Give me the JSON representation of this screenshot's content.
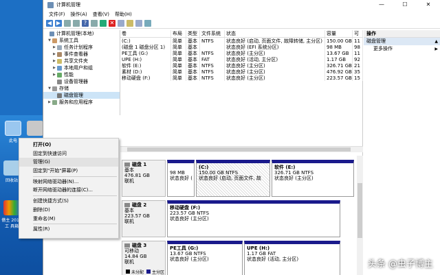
{
  "window": {
    "title": "计算机管理",
    "min": "—",
    "max": "☐",
    "close": "✕"
  },
  "menu": [
    "文件(F)",
    "操作(A)",
    "查看(V)",
    "帮助(H)"
  ],
  "tree": [
    {
      "label": "计算机管理(本地)",
      "level": 0,
      "arrow": ""
    },
    {
      "label": "系统工具",
      "level": 1,
      "arrow": "▼"
    },
    {
      "label": "任务计划程序",
      "level": 2,
      "arrow": "▶"
    },
    {
      "label": "事件查看器",
      "level": 2,
      "arrow": "▶"
    },
    {
      "label": "共享文件夹",
      "level": 2,
      "arrow": "▶"
    },
    {
      "label": "本地用户和组",
      "level": 2,
      "arrow": "▶"
    },
    {
      "label": "性能",
      "level": 2,
      "arrow": "▶"
    },
    {
      "label": "设备管理器",
      "level": 2,
      "arrow": ""
    },
    {
      "label": "存储",
      "level": 1,
      "arrow": "▼"
    },
    {
      "label": "磁盘管理",
      "level": 2,
      "arrow": "",
      "selected": true
    },
    {
      "label": "服务和应用程序",
      "level": 1,
      "arrow": "▶"
    }
  ],
  "volume_table": {
    "headers": [
      "卷",
      "布局",
      "类型",
      "文件系统",
      "状态",
      "容量",
      "可"
    ],
    "rows": [
      [
        "(C:)",
        "简单",
        "基本",
        "NTFS",
        "状态良好 (启动, 页面文件, 故障转储, 主分区)",
        "150.00 GB",
        "11"
      ],
      [
        "(磁盘 1 磁盘分区 1)",
        "简单",
        "基本",
        "",
        "状态良好 (EFI 系统分区)",
        "98 MB",
        "98"
      ],
      [
        "PE工具 (G:)",
        "简单",
        "基本",
        "NTFS",
        "状态良好 (主分区)",
        "13.67 GB",
        "11"
      ],
      [
        "UPE (H:)",
        "简单",
        "基本",
        "FAT",
        "状态良好 (活动, 主分区)",
        "1.17 GB",
        "92"
      ],
      [
        "软件 (E:)",
        "简单",
        "基本",
        "NTFS",
        "状态良好 (主分区)",
        "326.71 GB",
        "21"
      ],
      [
        "素材 (D:)",
        "简单",
        "基本",
        "NTFS",
        "状态良好 (主分区)",
        "476.92 GB",
        "35"
      ],
      [
        "移动硬盘 (F:)",
        "简单",
        "基本",
        "NTFS",
        "状态良好 (主分区)",
        "223.57 GB",
        "15"
      ]
    ]
  },
  "disks": [
    {
      "name": "磁盘 1",
      "type": "基本",
      "size": "476.81 GB",
      "status": "联机",
      "parts": [
        {
          "name": "",
          "size": "98 MB",
          "state": "状态良好 ("
        },
        {
          "name": "(C:)",
          "size": "150.00 GB NTFS",
          "state": "状态良好 (启动, 页面文件, 故",
          "selected": true
        },
        {
          "name": "软件 (E:)",
          "size": "326.71 GB NTFS",
          "state": "状态良好 (主分区)"
        }
      ]
    },
    {
      "name": "磁盘 2",
      "type": "基本",
      "size": "223.57 GB",
      "status": "联机",
      "parts": [
        {
          "name": "移动硬盘 (F:)",
          "size": "223.57 GB NTFS",
          "state": "状态良好 (主分区)"
        }
      ]
    },
    {
      "name": "磁盘 3",
      "type": "可移动",
      "size": "14.84 GB",
      "status": "联机",
      "parts": [
        {
          "name": "PE工具 (G:)",
          "size": "13.67 GB NTFS",
          "state": "状态良好 (主分区)"
        },
        {
          "name": "UPE (H:)",
          "size": "1.17 GB FAT",
          "state": "状态良好 (活动, 主分区)"
        }
      ]
    }
  ],
  "legend": {
    "unallocated": "未分配",
    "primary": "主分区",
    "unallocated_color": "#000000",
    "primary_color": "#1a1a8c"
  },
  "actions": {
    "header": "操作",
    "section": "磁盘管理",
    "more": "更多操作"
  },
  "context_menu": [
    {
      "label": "打开(O)",
      "bold": true
    },
    {
      "label": "固定到快速访问"
    },
    {
      "label": "管理(G)",
      "highlight": true
    },
    {
      "label": "固定到\"开始\"屏幕(P)",
      "sep_after": true
    },
    {
      "label": "映射网络驱动器(N)..."
    },
    {
      "label": "断开网络驱动器的连接(C)...",
      "sep_after": true
    },
    {
      "label": "创建快捷方式(S)"
    },
    {
      "label": "删除(D)"
    },
    {
      "label": "重命名(M)",
      "sep_after": true
    },
    {
      "label": "属性(R)"
    }
  ],
  "desktop_icons": [
    "此电",
    "回收站",
    "傲主 2019\n工 具箱"
  ],
  "watermark": "头条 @虫子博主"
}
